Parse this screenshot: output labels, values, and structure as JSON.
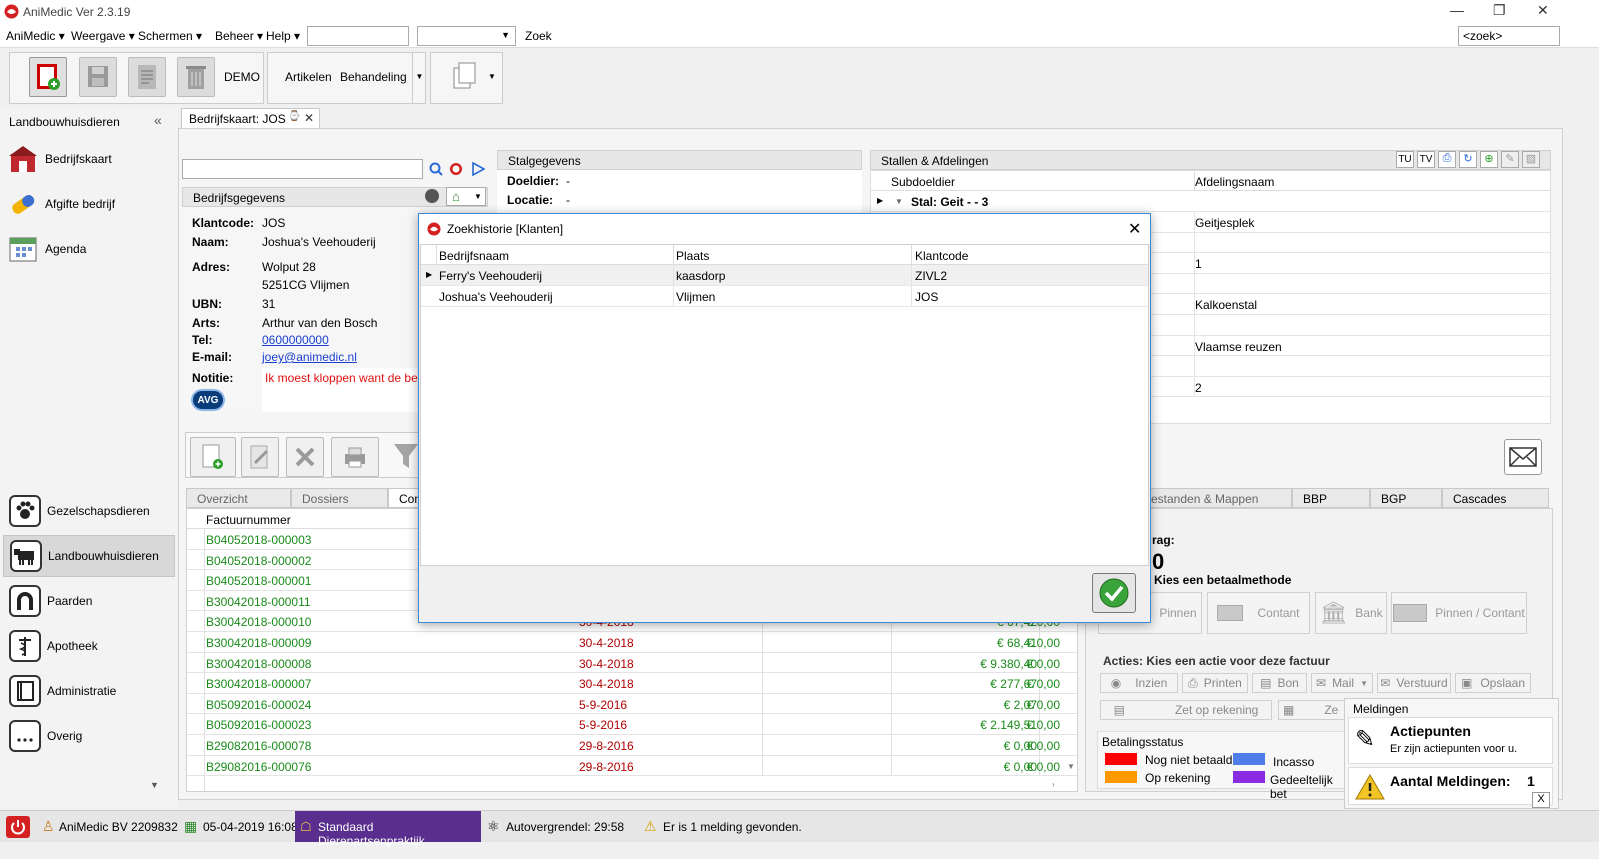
{
  "app": {
    "title": "AniMedic Ver 2.3.19"
  },
  "menu": {
    "items": [
      "AniMedic ▾",
      "Weergave ▾",
      "Schermen ▾",
      "Beheer ▾",
      "Help ▾"
    ],
    "search_label": "Zoek",
    "search_right_value": "<zoek>"
  },
  "toolbar": {
    "demo_label": "DEMO",
    "artikelen_label": "Artikelen",
    "behandeling_label": "Behandeling"
  },
  "sidebar": {
    "header": "Landbouwhuisdieren",
    "top_items": [
      "Bedrijfskaart",
      "Afgifte bedrijf",
      "Agenda"
    ],
    "nav_items": [
      "Gezelschapsdieren",
      "Landbouwhuisdieren",
      "Paarden",
      "Apotheek",
      "Administratie",
      "Overig"
    ],
    "selected": "Landbouwhuisdieren"
  },
  "document_tab": {
    "label": "Bedrijfskaart: JOS"
  },
  "bedrijfsgegevens": {
    "header": "Bedrijfsgegevens",
    "klantcode_label": "Klantcode:",
    "klantcode": "JOS",
    "naam_label": "Naam:",
    "naam": "Joshua's Veehouderij",
    "adres_label": "Adres:",
    "adres1": "Wolput 28",
    "adres2": "5251CG Vlijmen",
    "ubn_label": "UBN:",
    "ubn": "31",
    "arts_label": "Arts:",
    "arts": "Arthur van den Bosch",
    "tel_label": "Tel:",
    "tel": "0600000000",
    "email_label": "E-mail:",
    "email": "joey@animedic.nl",
    "notitie_label": "Notitie:",
    "notitie": "Ik moest kloppen want de bel do",
    "avg_badge": "AVG"
  },
  "stalgegevens": {
    "header": "Stalgegevens",
    "doeldier_label": "Doeldier:",
    "doeldier": "-",
    "locatie_label": "Locatie:",
    "locatie": "-"
  },
  "stallen": {
    "header": "Stallen & Afdelingen",
    "tools": [
      "TU",
      "TV"
    ],
    "col_subdoeldier": "Subdoeldier",
    "col_afdeling": "Afdelingsnaam",
    "group_label": "Stal: Geit -  - 3",
    "afdelingen": [
      "Geitjesplek",
      "",
      "1",
      "",
      "Kalkoenstal",
      "",
      "Vlaamse reuzen",
      "",
      "2"
    ]
  },
  "lower_tabs": {
    "left": [
      "Overzicht",
      "Dossiers",
      "Comm"
    ],
    "right": [
      "estanden & Mappen",
      "BBP",
      "BGP",
      "Cascades"
    ]
  },
  "invoices": {
    "header": "Factuurnummer",
    "rows": [
      {
        "nr": "B04052018-000003",
        "date": "",
        "amount": "",
        "open": ""
      },
      {
        "nr": "B04052018-000002",
        "date": "",
        "amount": "",
        "open": ""
      },
      {
        "nr": "B04052018-000001",
        "date": "",
        "amount": "",
        "open": ""
      },
      {
        "nr": "B30042018-000011",
        "date": "",
        "amount": "",
        "open": ""
      },
      {
        "nr": "B30042018-000010",
        "date": "30-4-2018",
        "amount": "€ 67,42",
        "open": "€ 0,00"
      },
      {
        "nr": "B30042018-000009",
        "date": "30-4-2018",
        "amount": "€ 68,41",
        "open": "€ 0,00"
      },
      {
        "nr": "B30042018-000008",
        "date": "30-4-2018",
        "amount": "€ 9.380,40",
        "open": "€ 0,00"
      },
      {
        "nr": "B30042018-000007",
        "date": "30-4-2018",
        "amount": "€ 277,67",
        "open": "€ 0,00"
      },
      {
        "nr": "B05092016-000024",
        "date": "5-9-2016",
        "amount": "€ 2,07",
        "open": "€ 0,00"
      },
      {
        "nr": "B05092016-000023",
        "date": "5-9-2016",
        "amount": "€ 2.149,51",
        "open": "€ 0,00"
      },
      {
        "nr": "B29082016-000078",
        "date": "29-8-2016",
        "amount": "€ 0,00",
        "open": "€ 0,00"
      },
      {
        "nr": "B29082016-000076",
        "date": "29-8-2016",
        "amount": "€ 0,00",
        "open": "€ 0,00"
      }
    ]
  },
  "payment": {
    "bedrag_label": "rag:",
    "bedrag_value": "0",
    "methode_label": "Kies een betaalmethode",
    "methods": [
      "Pinnen",
      "Contant",
      "Bank",
      "Pinnen / Contant"
    ],
    "acties_label": "Acties: Kies een actie voor deze factuur",
    "actions": [
      "Inzien",
      "Printen",
      "Bon",
      "Mail",
      "Verstuurd",
      "Opslaan"
    ],
    "zet_op_rekening": "Zet op rekening",
    "ze_partial": "Ze"
  },
  "betalingsstatus": {
    "header": "Betalingsstatus",
    "items": [
      {
        "label": "Nog niet betaald",
        "color": "#ff0000"
      },
      {
        "label": "Incasso",
        "color": "#4f7de8"
      },
      {
        "label": "Op rekening",
        "color": "#ff9900"
      },
      {
        "label": "Gedeeltelijk bet",
        "color": "#8a2be2"
      }
    ]
  },
  "meldingen": {
    "header": "Meldingen",
    "actiepunten_title": "Actiepunten",
    "actiepunten_text": "Er zijn actiepunten voor u.",
    "aantal_label": "Aantal Meldingen:",
    "aantal_value": "1",
    "close": "X"
  },
  "dialog": {
    "title": "Zoekhistorie [Klanten]",
    "columns": [
      "Bedrijfsnaam",
      "Plaats",
      "Klantcode"
    ],
    "rows": [
      {
        "bedrijfsnaam": "Ferry's Veehouderij",
        "plaats": "kaasdorp",
        "klantcode": "ZIVL2"
      },
      {
        "bedrijfsnaam": "Joshua's Veehouderij",
        "plaats": "Vlijmen",
        "klantcode": "JOS"
      }
    ]
  },
  "statusbar": {
    "user": "AniMedic  BV 2209832",
    "datetime": "05-04-2019 16:08",
    "practice": "Standaard Dierenartsenpraktijk",
    "autolock": "Autovergrendel:  29:58",
    "message": "Er is 1 melding gevonden."
  }
}
